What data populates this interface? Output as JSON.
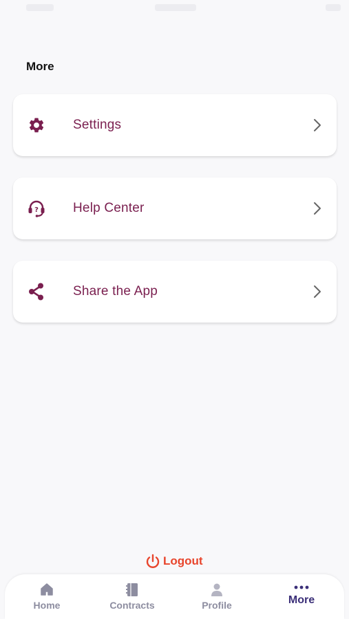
{
  "header": {
    "title": "More"
  },
  "menu": [
    {
      "label": "Settings",
      "icon": "gear-icon"
    },
    {
      "label": "Help Center",
      "icon": "headset-help-icon"
    },
    {
      "label": "Share the App",
      "icon": "share-icon"
    }
  ],
  "logout": {
    "label": "Logout",
    "icon": "power-icon"
  },
  "tabs": [
    {
      "label": "Home",
      "icon": "home-icon"
    },
    {
      "label": "Contracts",
      "icon": "contracts-icon"
    },
    {
      "label": "Profile",
      "icon": "profile-icon"
    },
    {
      "label": "More",
      "icon": "more-dots-icon",
      "active": true
    }
  ],
  "colors": {
    "accent": "#7a1f4f",
    "logout": "#e8452c",
    "tab_active": "#3b2f78",
    "tab_inactive": "#8d8da0"
  }
}
